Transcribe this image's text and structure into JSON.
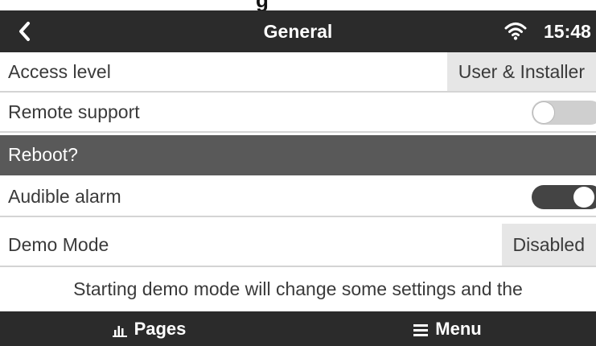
{
  "header": {
    "title": "General",
    "time": "15:48",
    "back_icon": "chevron-left-icon",
    "wifi_icon": "wifi-icon"
  },
  "top_strip_text": "g",
  "settings": {
    "access_level": {
      "label": "Access level",
      "value": "User & Installer"
    },
    "remote_support": {
      "label": "Remote support",
      "toggle": "off"
    },
    "reboot": {
      "label": "Reboot?"
    },
    "audible_alarm": {
      "label": "Audible alarm",
      "toggle": "on"
    },
    "demo_mode": {
      "label": "Demo Mode",
      "value": "Disabled"
    }
  },
  "note": "Starting demo mode will change some settings and the",
  "footer": {
    "pages_label": "Pages",
    "pages_icon": "bar-chart-icon",
    "menu_label": "Menu",
    "menu_icon": "hamburger-menu-icon"
  },
  "colors": {
    "header_bg": "#2b2b2b",
    "section_bg": "#595959",
    "toggle_on": "#444444",
    "toggle_off": "#cfcfcf"
  }
}
